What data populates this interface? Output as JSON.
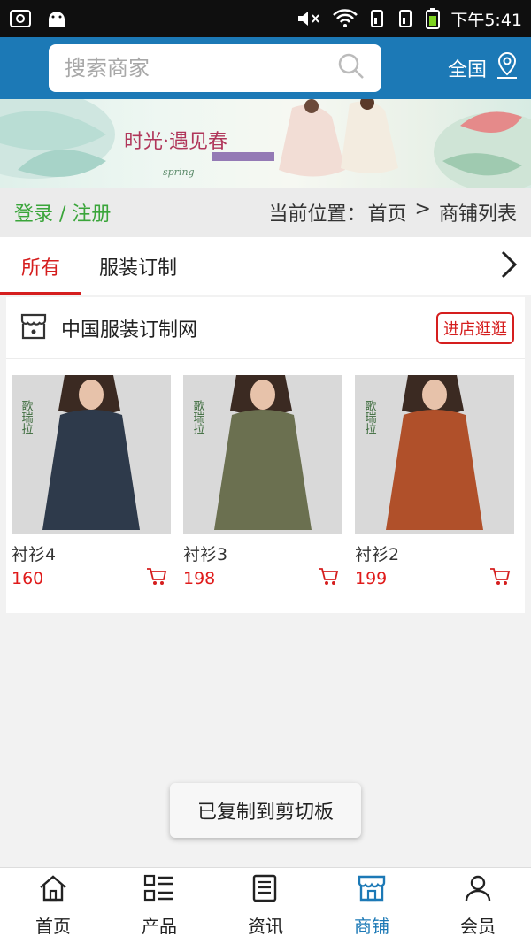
{
  "status_bar": {
    "time": "下午5:41"
  },
  "header": {
    "search_placeholder": "搜索商家",
    "region_label": "全国"
  },
  "banner": {
    "headline": "时光·遇见春",
    "subline": "spring"
  },
  "info_bar": {
    "login_label": "登录 / 注册",
    "breadcrumb_prefix": "当前位置：",
    "breadcrumb_home": "首页",
    "breadcrumb_sep": " > ",
    "breadcrumb_current": "商铺列表"
  },
  "tabs": [
    {
      "label": "所有"
    },
    {
      "label": "服装订制"
    }
  ],
  "store": {
    "name": "中国服装订制网",
    "visit_label": "进店逛逛",
    "products": [
      {
        "name": "衬衫4",
        "price": "160",
        "color": "#2e3a4b",
        "brand": "歌瑞拉"
      },
      {
        "name": "衬衫3",
        "price": "198",
        "color": "#6b7050",
        "brand": "歌瑞拉"
      },
      {
        "name": "衬衫2",
        "price": "199",
        "color": "#b0502a",
        "brand": "歌瑞拉"
      }
    ]
  },
  "toast": {
    "message": "已复制到剪切板"
  },
  "bottom_nav": [
    {
      "label": "首页",
      "icon": "home-icon"
    },
    {
      "label": "产品",
      "icon": "grid-list-icon"
    },
    {
      "label": "资讯",
      "icon": "news-icon"
    },
    {
      "label": "商铺",
      "icon": "store-icon",
      "active": true
    },
    {
      "label": "会员",
      "icon": "user-icon"
    }
  ],
  "colors": {
    "brand_blue": "#1c79b6",
    "accent_red": "#d51e1e",
    "login_green": "#3aa53a"
  }
}
